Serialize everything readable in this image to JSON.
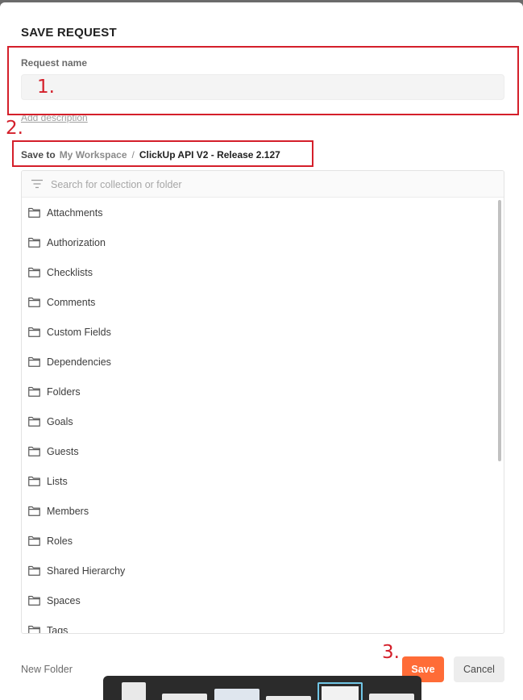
{
  "dialog": {
    "title": "SAVE REQUEST",
    "request_name_label": "Request name",
    "request_name_value": "",
    "add_description": "Add description",
    "save_to_label": "Save to",
    "workspace": "My Workspace",
    "separator": "/",
    "collection": "ClickUp API V2 - Release 2.127",
    "search_placeholder": "Search for collection or folder",
    "items": [
      {
        "label": "Attachments"
      },
      {
        "label": "Authorization"
      },
      {
        "label": "Checklists"
      },
      {
        "label": "Comments"
      },
      {
        "label": "Custom Fields"
      },
      {
        "label": "Dependencies"
      },
      {
        "label": "Folders"
      },
      {
        "label": "Goals"
      },
      {
        "label": "Guests"
      },
      {
        "label": "Lists"
      },
      {
        "label": "Members"
      },
      {
        "label": "Roles"
      },
      {
        "label": "Shared Hierarchy"
      },
      {
        "label": "Spaces"
      },
      {
        "label": "Tags"
      }
    ],
    "new_folder": "New Folder",
    "save_button": "Save",
    "cancel_button": "Cancel"
  },
  "annotations": [
    "1.",
    "2.",
    "3."
  ],
  "colors": {
    "accent": "#ff6c37",
    "annotation": "#d41f2a",
    "taskbar_active": "#71c6e6"
  }
}
